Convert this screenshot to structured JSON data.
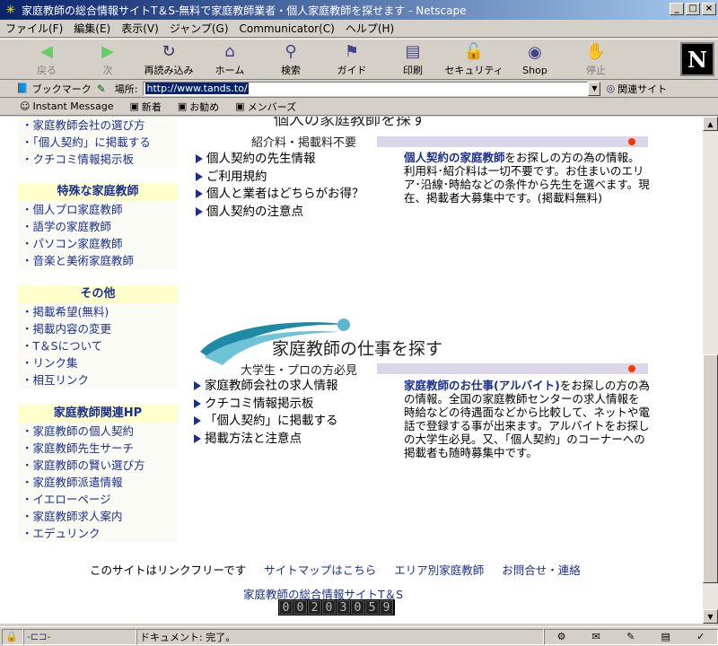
{
  "window": {
    "title": "家庭教師の総合情報サイトT＆S-無料で家庭教師業者・個人家庭教師を探せます - Netscape"
  },
  "menu": [
    "ファイル(F)",
    "編集(E)",
    "表示(V)",
    "ジャンプ(G)",
    "Communicator(C)",
    "ヘルプ(H)"
  ],
  "toolbar": {
    "back": "戻る",
    "forward": "次",
    "reload": "再読み込み",
    "home": "ホーム",
    "search": "検索",
    "guide": "ガイド",
    "print": "印刷",
    "security": "セキュリティ",
    "shop": "Shop",
    "stop": "停止"
  },
  "location": {
    "bookmarks": "ブックマーク",
    "label": "場所:",
    "url": "http://www.tands.to/",
    "related": "関連サイト"
  },
  "personal": [
    "Instant Message",
    "新着",
    "お勧め",
    "メンバーズ"
  ],
  "sidebar": {
    "top_items": [
      "・家庭教師会社の選び方",
      "・「個人契約」に掲載する",
      "・クチコミ情報掲示板"
    ],
    "sections": [
      {
        "title": "特殊な家庭教師",
        "items": [
          "・個人プロ家庭教師",
          "・語学の家庭教師",
          "・パソコン家庭教師",
          "・音楽と美術家庭教師"
        ]
      },
      {
        "title": "その他",
        "items": [
          "・掲載希望(無料)",
          "・掲載内容の変更",
          "・T＆Sについて",
          "・リンク集",
          "・相互リンク"
        ]
      },
      {
        "title": "家庭教師関連HP",
        "items": [
          "・家庭教師の個人契約",
          "・家庭教師先生サーチ",
          "・家庭教師の賢い選び方",
          "・家庭教師派遣情報",
          "・イエローページ",
          "・家庭教師求人案内",
          "・エデュリンク"
        ]
      }
    ]
  },
  "section1": {
    "heading_partial": "個人の家庭教師を探す",
    "subtitle": "紹介料・掲載料不要",
    "links": [
      "個人契約の先生情報",
      "ご利用規約",
      "個人と業者はどちらがお得？",
      "個人契約の注意点"
    ],
    "desc_lead": "個人契約の家庭教師",
    "desc_body": "をお探しの方の為の情報。利用料･紹介料は一切不要です。お住まいのエリア･沿線･時給などの条件から先生を選べます。現在、掲載者大募集中です。(掲載料無料)"
  },
  "section2": {
    "heading": "家庭教師の仕事を探す",
    "subtitle": "大学生・プロの方必見",
    "links": [
      "家庭教師会社の求人情報",
      "クチコミ情報掲示板",
      "「個人契約」に掲載する",
      "掲載方法と注意点"
    ],
    "desc_lead": "家庭教師のお仕事(アルバイト)",
    "desc_body": "をお探しの方の為の情報。全国の家庭教師センターの求人情報を時給などの待遇面などから比較して、ネットや電話で登録する事が出来ます。アルバイトをお探しの大学生必見。又、「個人契約」のコーナーへの掲載者も随時募集中です。"
  },
  "footer": {
    "links": [
      "このサイトはリンクフリーです",
      "サイトマップはこちら",
      "エリア別家庭教師",
      "お問合せ・連絡"
    ],
    "site": "家庭教師の総合情報サイトT＆S",
    "counter": [
      "0",
      "0",
      "2",
      "0",
      "3",
      "0",
      "5",
      "9"
    ]
  },
  "status": {
    "text": "ドキュメント: 完了。"
  }
}
